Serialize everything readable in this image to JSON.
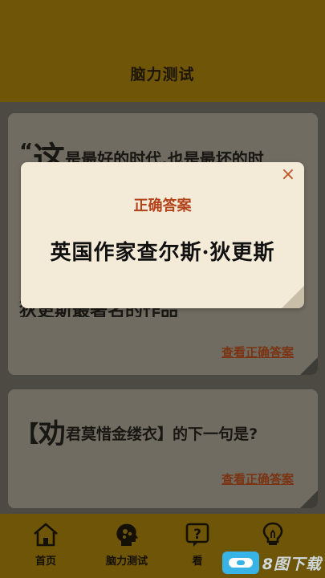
{
  "header": {
    "title": "脑力测试"
  },
  "cards": [
    {
      "quote": {
        "open_mark": "“",
        "big_char": "这",
        "rest": "是最好的时代,也是最坏的时"
      },
      "hidden_line": "狄更斯最著名的作品",
      "view_answer": "查看正确答案"
    },
    {
      "riddle": {
        "open_bracket": "【",
        "big_char": "劝",
        "rest": "君莫惜金缕衣",
        "close_bracket": "】",
        "tail": "的下一句是",
        "question_mark": "?"
      },
      "view_answer": "查看正确答案"
    }
  ],
  "modal": {
    "title": "正确答案",
    "answer": "英国作家查尔斯·狄更斯",
    "close_icon": "×"
  },
  "tabbar": {
    "items": [
      {
        "label": "首页",
        "icon": "home-icon"
      },
      {
        "label": "脑力测试",
        "icon": "brain-head-icon"
      },
      {
        "label": "看",
        "icon": "question-box-icon"
      },
      {
        "label": "",
        "icon": "lightbulb-icon"
      }
    ]
  },
  "watermark": {
    "text": "8图下载"
  },
  "colors": {
    "header_bg": "#6e5508",
    "modal_bg": "#f3ead7",
    "accent": "#b2431b",
    "link": "#7a3413"
  }
}
